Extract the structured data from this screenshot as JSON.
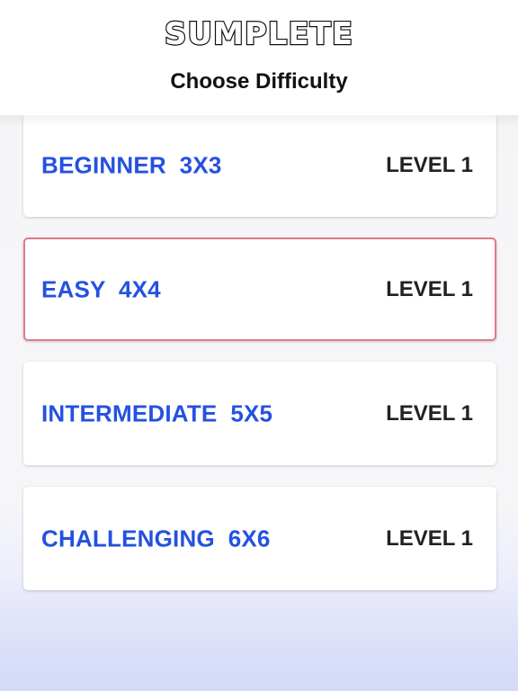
{
  "header": {
    "title": "SUMPLETE",
    "subtitle": "Choose Difficulty"
  },
  "difficulties": [
    {
      "name": "BEGINNER  3X3",
      "level": "LEVEL 1"
    },
    {
      "name": "EASY  4X4",
      "level": "LEVEL 1",
      "selected": true
    },
    {
      "name": "INTERMEDIATE  5X5",
      "level": "LEVEL 1"
    },
    {
      "name": "CHALLENGING  6X6",
      "level": "LEVEL 1"
    }
  ],
  "colors": {
    "accent": "#2451e0",
    "selected_border": "#e07a8a",
    "text_dark": "#222222"
  }
}
